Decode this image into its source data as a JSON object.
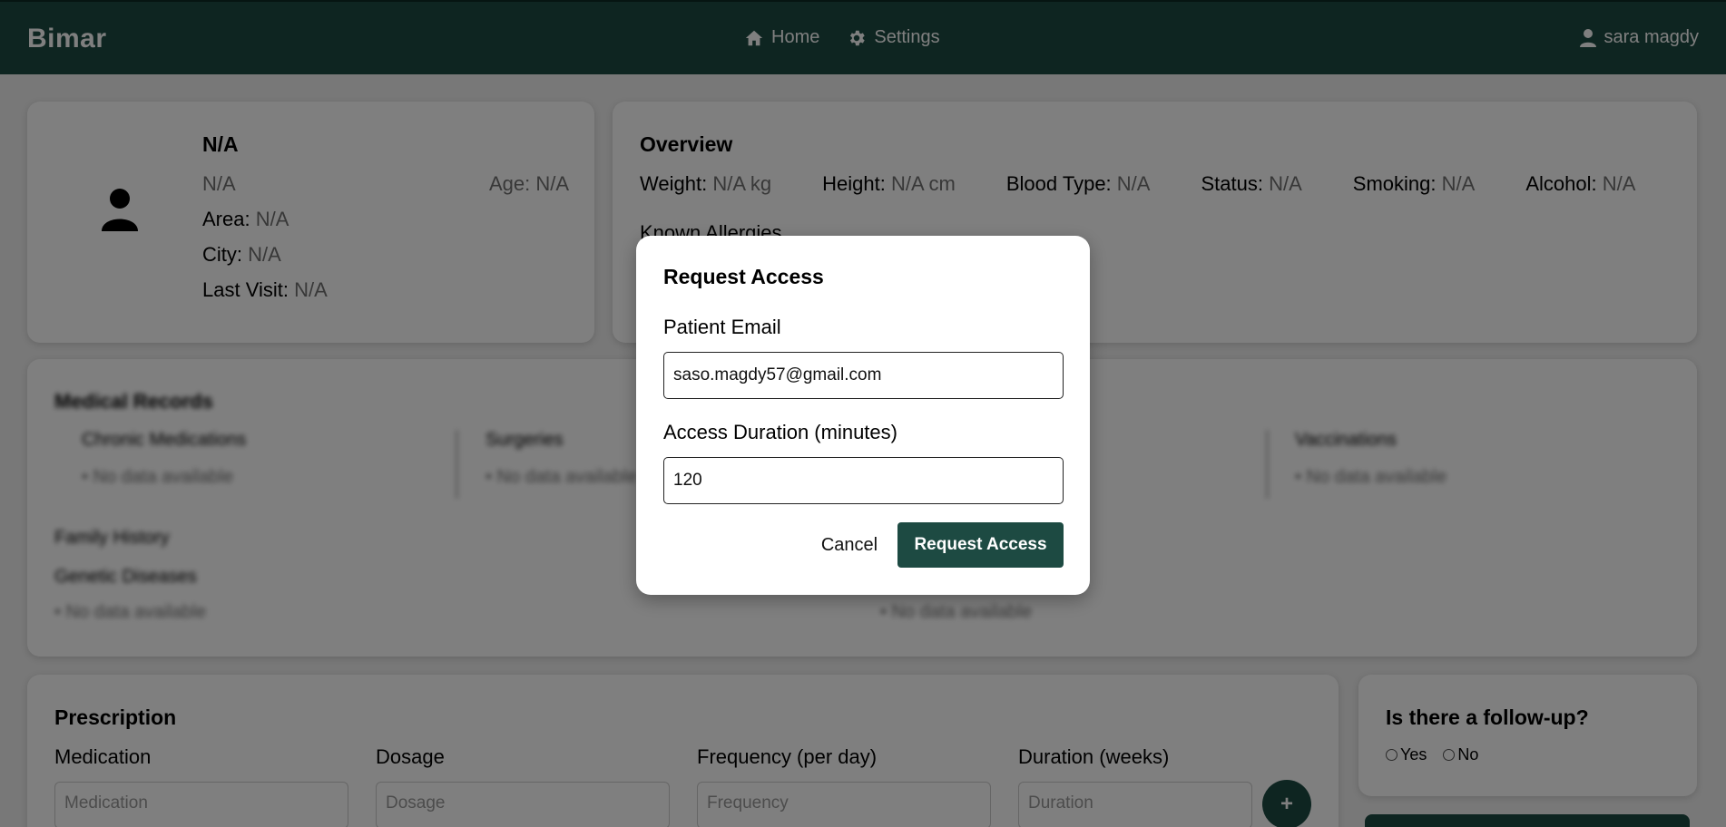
{
  "nav": {
    "brand": "Bimar",
    "links": [
      {
        "label": "Home",
        "icon": "home-icon"
      },
      {
        "label": "Settings",
        "icon": "gear-icon"
      }
    ],
    "user": "sara magdy"
  },
  "patient": {
    "name": "N/A",
    "subtitle": "N/A",
    "age_label": "Age: N/A",
    "area_label": "Area:",
    "area_value": "N/A",
    "city_label": "City:",
    "city_value": "N/A",
    "last_visit_label": "Last Visit:",
    "last_visit_value": "N/A"
  },
  "overview": {
    "title": "Overview",
    "items": [
      {
        "label": "Weight:",
        "value": "N/A kg"
      },
      {
        "label": "Height:",
        "value": "N/A cm"
      },
      {
        "label": "Blood Type:",
        "value": "N/A"
      },
      {
        "label": "Status:",
        "value": "N/A"
      },
      {
        "label": "Smoking:",
        "value": "N/A"
      },
      {
        "label": "Alcohol:",
        "value": "N/A"
      }
    ],
    "allergies_label": "Known Allergies"
  },
  "records": {
    "title": "Medical Records",
    "columns": [
      {
        "title": "Chronic Medications",
        "value": "• No data available"
      },
      {
        "title": "Surgeries",
        "value": "• No data available"
      },
      {
        "title": "Vaccinations",
        "value": "• No data available"
      }
    ],
    "family_history": "Family History",
    "genetic_diseases": "Genetic Diseases",
    "left_value": "• No data available",
    "right_value": "• No data available"
  },
  "prescription": {
    "title": "Prescription",
    "fields": [
      {
        "label": "Medication",
        "placeholder": "Medication"
      },
      {
        "label": "Dosage",
        "placeholder": "Dosage"
      },
      {
        "label": "Frequency (per day)",
        "placeholder": "Frequency"
      },
      {
        "label": "Duration (weeks)",
        "placeholder": "Duration"
      }
    ],
    "add_label": "+"
  },
  "followup": {
    "title": "Is there a follow-up?",
    "yes": "Yes",
    "no": "No"
  },
  "modal": {
    "title": "Request Access",
    "email_label": "Patient Email",
    "email_value": "saso.magdy57@gmail.com",
    "duration_label": "Access Duration (minutes)",
    "duration_value": "120",
    "cancel_label": "Cancel",
    "submit_label": "Request Access"
  },
  "colors": {
    "primary": "#1d4a42",
    "overlay": "rgba(0,0,0,0.5)"
  }
}
